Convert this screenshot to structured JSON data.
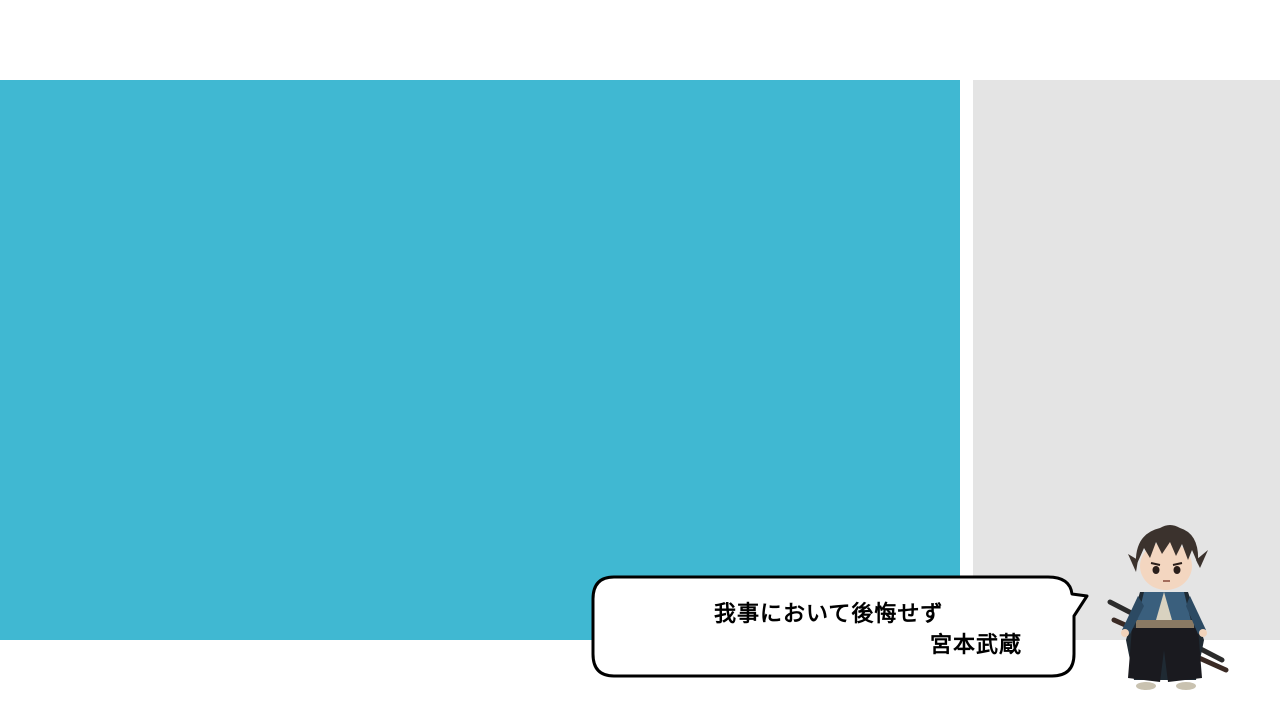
{
  "colors": {
    "main_panel": "#40B8D2",
    "side_panel": "#E4E4E4",
    "background": "#FFFFFF",
    "bubble_fill": "#FFFFFF",
    "bubble_stroke": "#000000",
    "text": "#000000"
  },
  "speech_bubble": {
    "quote": "我事において後悔せず",
    "author": "宮本武蔵"
  },
  "character": {
    "icon": "samurai-character-icon"
  }
}
